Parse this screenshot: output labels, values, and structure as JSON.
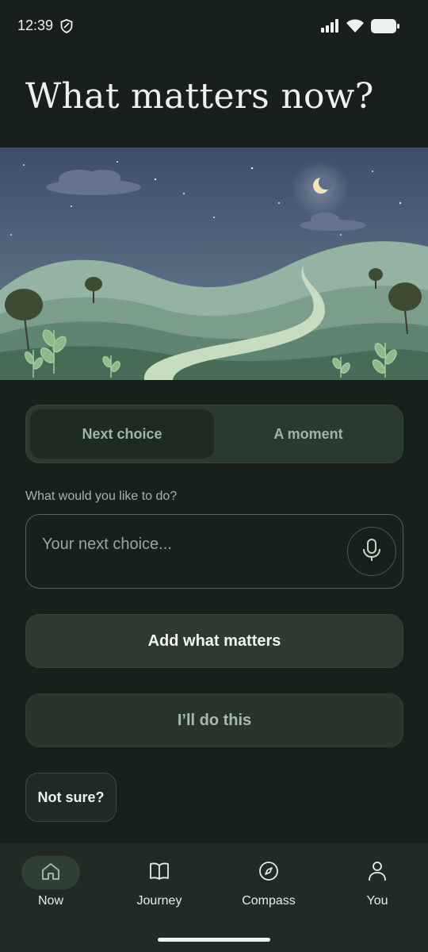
{
  "status_bar": {
    "time": "12:39",
    "icons": [
      "shield-icon",
      "signal-icon",
      "wifi-icon",
      "battery-icon"
    ]
  },
  "header": {
    "title": "What matters now?"
  },
  "hero": {
    "alt": "night landscape with hills, path, moon and plants"
  },
  "segmented": {
    "tabs": [
      {
        "label": "Next choice",
        "active": true
      },
      {
        "label": "A moment",
        "active": false
      }
    ]
  },
  "form": {
    "prompt": "What would you like to do?",
    "input_value": "",
    "input_placeholder": "Your next choice...",
    "mic_icon": "microphone-icon"
  },
  "buttons": {
    "add": "Add what matters",
    "do": "I’ll do this",
    "not_sure": "Not sure?"
  },
  "nav": {
    "items": [
      {
        "label": "Now",
        "icon": "home-icon",
        "active": true
      },
      {
        "label": "Journey",
        "icon": "book-icon",
        "active": false
      },
      {
        "label": "Compass",
        "icon": "compass-icon",
        "active": false
      },
      {
        "label": "You",
        "icon": "person-icon",
        "active": false
      }
    ]
  },
  "colors": {
    "background": "#18201c",
    "accent": "#9fb7a2",
    "surface": "#2c3a31"
  }
}
